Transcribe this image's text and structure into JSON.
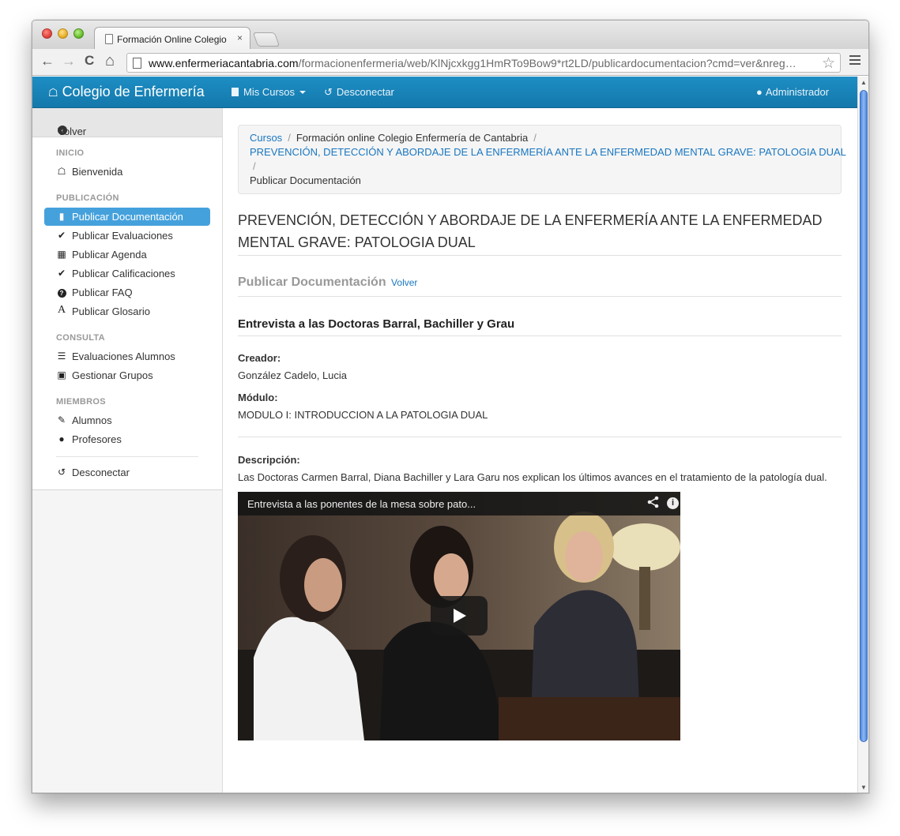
{
  "browser": {
    "tab_title": "Formación Online Colegio",
    "tab_close": "×",
    "url_domain": "www.enfermeriacantabria.com",
    "url_path": "/formacionenfermeria/web/KlNjcxkgg1HmRTo9Bow9*rt2LD/publicardocumentacion?cmd=ver&nreg…",
    "back_glyph": "←",
    "forward_glyph": "→",
    "reload_glyph": "C",
    "home_glyph": "⌂",
    "star_glyph": "☆"
  },
  "navbar": {
    "brand": "Colegio de Enfermería",
    "mis_cursos": "Mis Cursos",
    "desconectar": "Desconectar",
    "admin": "Administrador"
  },
  "sidebar": {
    "back": "Volver a Mis Cursos",
    "sections": [
      {
        "heading": "INICIO",
        "items": [
          {
            "label": "Bienvenida",
            "icon": "home-icon"
          }
        ]
      },
      {
        "heading": "PUBLICACIÓN",
        "items": [
          {
            "label": "Publicar Documentación",
            "icon": "file-icon",
            "active": true
          },
          {
            "label": "Publicar Evaluaciones",
            "icon": "check-icon"
          },
          {
            "label": "Publicar Agenda",
            "icon": "calendar-icon"
          },
          {
            "label": "Publicar Calificaciones",
            "icon": "check-icon"
          },
          {
            "label": "Publicar FAQ",
            "icon": "question-circle-icon"
          },
          {
            "label": "Publicar Glosario",
            "icon": "font-icon"
          }
        ]
      },
      {
        "heading": "CONSULTA",
        "items": [
          {
            "label": "Evaluaciones Alumnos",
            "icon": "list-icon"
          },
          {
            "label": "Gestionar Grupos",
            "icon": "briefcase-icon"
          }
        ]
      },
      {
        "heading": "MIEMBROS",
        "items": [
          {
            "label": "Alumnos",
            "icon": "pencil-icon"
          },
          {
            "label": "Profesores",
            "icon": "user-icon"
          }
        ]
      }
    ],
    "logout": "Desconectar"
  },
  "breadcrumb": {
    "cursos": "Cursos",
    "sep": "/",
    "formacion": "Formación online Colegio Enfermería de Cantabria",
    "curso": "PREVENCIÓN, DETECCIÓN Y ABORDAJE DE LA ENFERMERÍA ANTE LA ENFERMEDAD MENTAL GRAVE: PATOLOGIA DUAL",
    "current": "Publicar Documentación"
  },
  "page": {
    "title_line1": "PREVENCIÓN, DETECCIÓN Y ABORDAJE DE LA ENFERMERÍA ANTE LA ENFERMEDAD",
    "title_line2": "MENTAL GRAVE: PATOLOGIA DUAL",
    "section": "Publicar Documentación",
    "volver": "Volver",
    "doc_title": "Entrevista a las Doctoras Barral, Bachiller y Grau",
    "creador_label": "Creador:",
    "creador": "González Cadelo, Lucia",
    "modulo_label": "Módulo:",
    "modulo": "MODULO I: INTRODUCCION A LA PATOLOGIA DUAL",
    "descripcion_label": "Descripción:",
    "descripcion": "Las Doctoras Carmen Barral, Diana Bachiller y Lara Garu nos explican los últimos avances en el tratamiento de la patología dual.",
    "video_title": "Entrevista a las ponentes de la mesa sobre pato...",
    "video_info": "i"
  },
  "colors": {
    "navbar": "#1a86bd",
    "active_item": "#45a1dc",
    "link": "#1a77c0"
  }
}
